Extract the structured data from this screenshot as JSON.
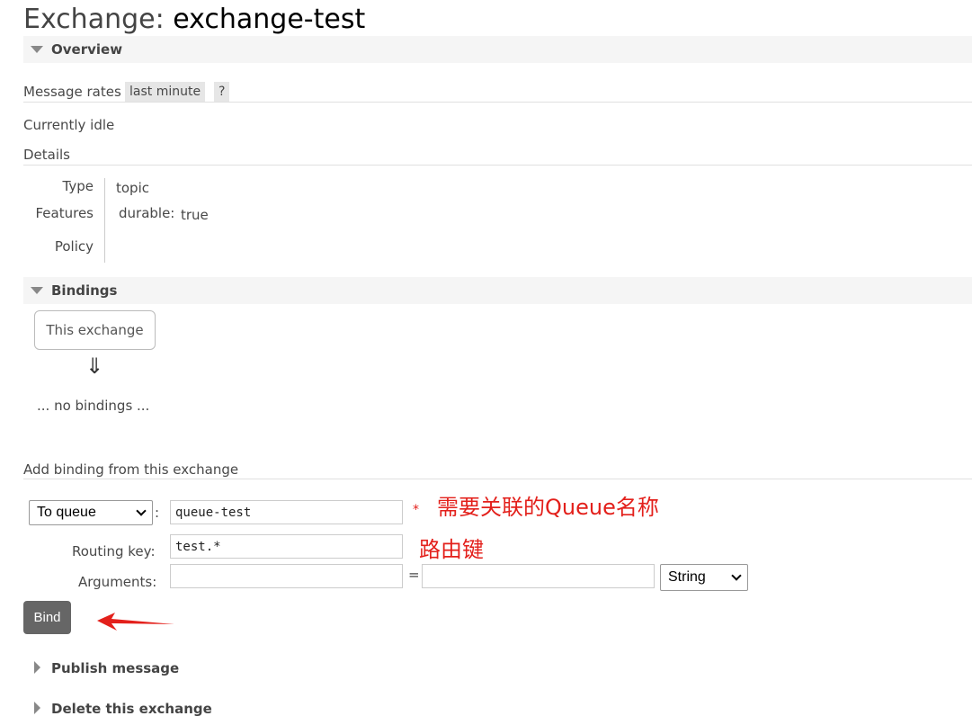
{
  "header": {
    "prefix": "Exchange: ",
    "name": "exchange-test"
  },
  "overview": {
    "title": "Overview",
    "message_rates_label": "Message rates",
    "rate_period": "last minute",
    "help": "?",
    "status": "Currently idle",
    "details_label": "Details",
    "details": {
      "type_label": "Type",
      "type_value": "topic",
      "features_label": "Features",
      "durable_label": "durable:",
      "durable_value": "true",
      "policy_label": "Policy"
    }
  },
  "bindings": {
    "title": "Bindings",
    "this_exchange": "This exchange",
    "arrow": "⇓",
    "empty": "... no bindings ..."
  },
  "add_binding": {
    "title": "Add binding from this exchange",
    "destination_type": "To queue",
    "colon": ":",
    "destination_value": "queue-test",
    "required_mark": "*",
    "routing_key_label": "Routing key:",
    "routing_key_value": "test.*",
    "arguments_label": "Arguments:",
    "equals": "=",
    "arg_type": "String",
    "bind_label": "Bind"
  },
  "annotations": {
    "queue_note": "需要关联的Queue名称",
    "routing_note": "路由键",
    "accent": "#e3201b"
  },
  "sections": {
    "publish": "Publish message",
    "delete": "Delete this exchange"
  }
}
